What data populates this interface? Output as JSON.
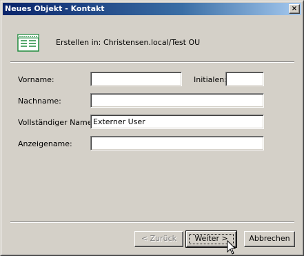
{
  "window": {
    "title": "Neues Objekt - Kontakt",
    "close_glyph": "×"
  },
  "header": {
    "icon": "contact-card-icon",
    "created_in_label": "Erstellen in:",
    "created_in_value": "Christensen.local/Test OU"
  },
  "form": {
    "first_name": {
      "label": "Vorname:",
      "value": ""
    },
    "initials": {
      "label": "Initialen:",
      "value": ""
    },
    "last_name": {
      "label": "Nachname:",
      "value": ""
    },
    "full_name": {
      "label": "Vollständiger Name:",
      "value": "Externer User"
    },
    "display_name": {
      "label": "Anzeigename:",
      "value": ""
    }
  },
  "buttons": {
    "back": "< Zurück",
    "next": "Weiter >",
    "cancel": "Abbrechen"
  },
  "colors": {
    "dialog_bg": "#d4d0c8",
    "title_bar_start": "#0a246a",
    "title_bar_end": "#a6caf0",
    "icon_green": "#1f8a3c"
  }
}
